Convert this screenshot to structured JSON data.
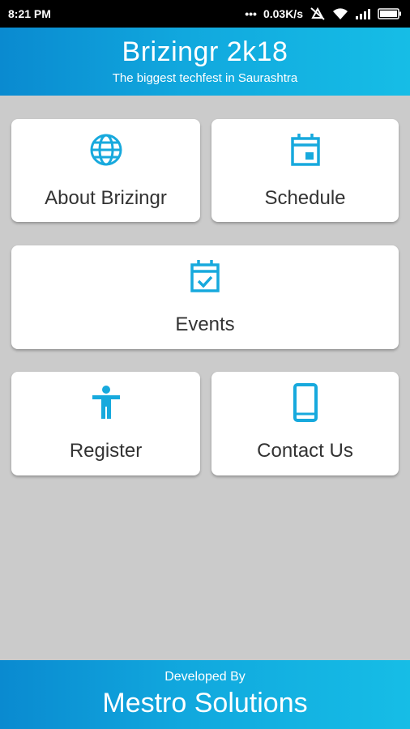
{
  "status_bar": {
    "time": "8:21 PM",
    "net_speed": "0.03K/s",
    "icons": [
      "dots-icon",
      "data-off-icon",
      "wifi-icon",
      "signal-icon",
      "battery-icon"
    ]
  },
  "header": {
    "title": "Brizingr 2k18",
    "subtitle": "The biggest techfest in Saurashtra"
  },
  "menu": {
    "about": {
      "label": "About Brizingr",
      "icon": "globe-icon"
    },
    "schedule": {
      "label": "Schedule",
      "icon": "calendar-icon"
    },
    "events": {
      "label": "Events",
      "icon": "calendar-check-icon"
    },
    "register": {
      "label": "Register",
      "icon": "person-icon"
    },
    "contact": {
      "label": "Contact Us",
      "icon": "phone-icon"
    }
  },
  "footer": {
    "developed_by": "Developed By",
    "company": "Mestro Solutions"
  },
  "colors": {
    "accent": "#17a9dd",
    "header_start": "#0a8ad0",
    "header_end": "#16bde6",
    "background": "#cbcbcb",
    "card_text": "#333333"
  }
}
